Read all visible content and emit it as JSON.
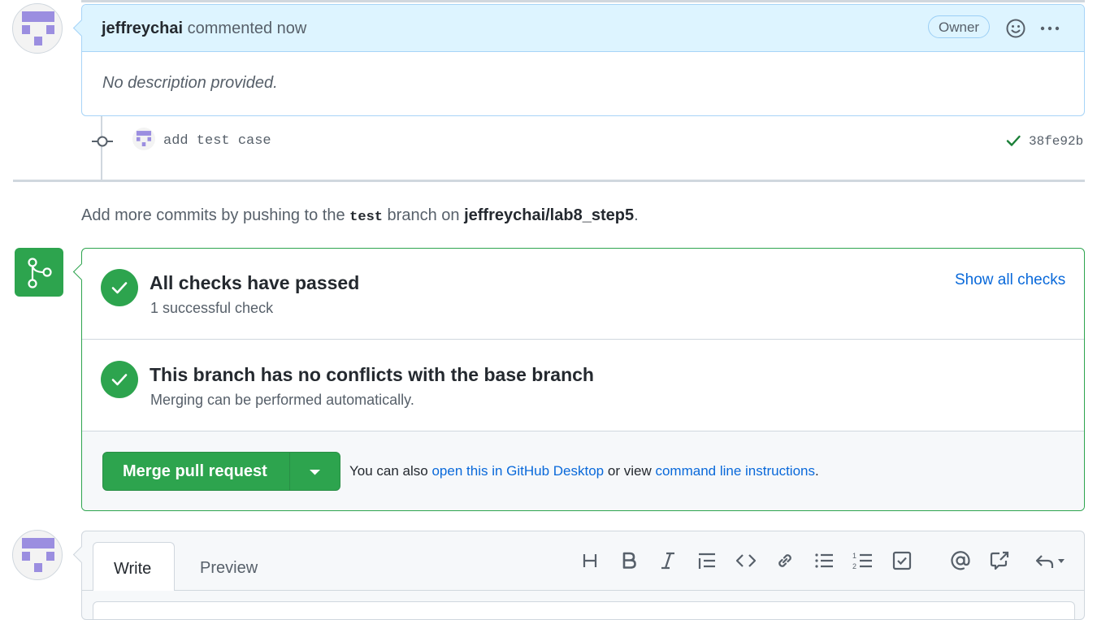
{
  "comment": {
    "author": "jeffreychai",
    "action": "commented now",
    "badge": "Owner",
    "body": "No description provided."
  },
  "commit": {
    "message": "add test case",
    "sha": "38fe92b"
  },
  "push_hint": {
    "prefix": "Add more commits by pushing to the",
    "branch": "test",
    "middle": "branch on",
    "repo": "jeffreychai/lab8_step5",
    "suffix": "."
  },
  "checks": {
    "title": "All checks have passed",
    "subtitle": "1 successful check",
    "show_all": "Show all checks"
  },
  "conflicts": {
    "title": "This branch has no conflicts with the base branch",
    "subtitle": "Merging can be performed automatically."
  },
  "merge": {
    "button_label": "Merge pull request",
    "hint_prefix": "You can also",
    "desktop_link": "open this in GitHub Desktop",
    "hint_middle": "or view",
    "cli_link": "command line instructions",
    "hint_suffix": "."
  },
  "editor": {
    "tabs": [
      "Write",
      "Preview"
    ],
    "toolbar": [
      "heading-icon",
      "bold-icon",
      "italic-icon",
      "quote-icon",
      "code-icon",
      "link-icon",
      "unordered-list-icon",
      "ordered-list-icon",
      "task-list-icon",
      "mention-icon",
      "cross-reference-icon",
      "reply-icon"
    ]
  },
  "colors": {
    "success": "#2da44e",
    "link": "#0969da",
    "header_bg": "#ddf4ff",
    "avatar": "#9b8ee0"
  }
}
